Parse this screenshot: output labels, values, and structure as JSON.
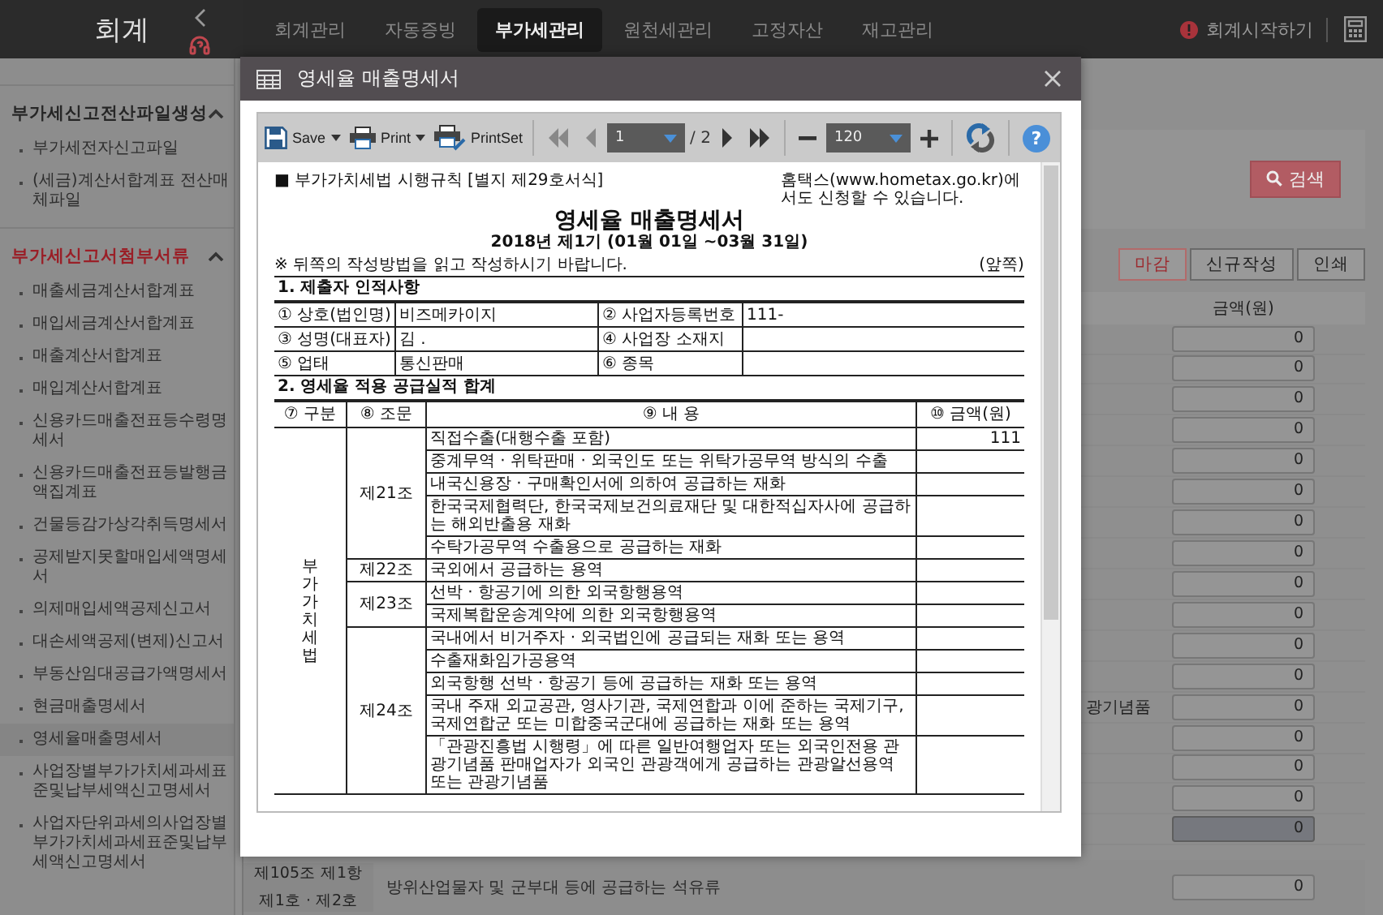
{
  "app": {
    "title": "회계"
  },
  "nav": [
    {
      "label": "회계관리",
      "selected": false
    },
    {
      "label": "자동증빙",
      "selected": false
    },
    {
      "label": "부가세관리",
      "selected": true
    },
    {
      "label": "원천세관리",
      "selected": false
    },
    {
      "label": "고정자산",
      "selected": false
    },
    {
      "label": "재고관리",
      "selected": false
    }
  ],
  "start_link": "회계시작하기",
  "sidebar": [
    {
      "title": "부가세신고전산파일생성",
      "active": false,
      "expanded": true,
      "items": [
        {
          "label": "부가세전자신고파일",
          "selected": false
        },
        {
          "label": "(세금)계산서합계표 전산매체파일",
          "selected": false
        }
      ]
    },
    {
      "title": "부가세신고서첨부서류",
      "active": true,
      "expanded": true,
      "items": [
        {
          "label": "매출세금계산서합계표",
          "selected": false
        },
        {
          "label": "매입세금계산서합계표",
          "selected": false
        },
        {
          "label": "매출계산서합계표",
          "selected": false
        },
        {
          "label": "매입계산서합계표",
          "selected": false
        },
        {
          "label": "신용카드매출전표등수령명세서",
          "selected": false
        },
        {
          "label": "신용카드매출전표등발행금액집계표",
          "selected": false
        },
        {
          "label": "건물등감가상각취득명세서",
          "selected": false
        },
        {
          "label": "공제받지못할매입세액명세서",
          "selected": false
        },
        {
          "label": "의제매입세액공제신고서",
          "selected": false
        },
        {
          "label": "대손세액공제(변제)신고서",
          "selected": false
        },
        {
          "label": "부동산임대공급가액명세서",
          "selected": false
        },
        {
          "label": "현금매출명세서",
          "selected": false
        },
        {
          "label": "영세율매출명세서",
          "selected": true
        },
        {
          "label": "사업장별부가가치세과세표준및납부세액신고명세서",
          "selected": false
        },
        {
          "label": "사업자단위과세의사업장별부가가치세과세표준및납부세액신고명세서",
          "selected": false
        }
      ]
    }
  ],
  "main": {
    "search_button": "검색",
    "actions": [
      {
        "label": "마감",
        "kind": "primary"
      },
      {
        "label": "신규작성",
        "kind": "normal"
      },
      {
        "label": "인쇄",
        "kind": "normal"
      }
    ],
    "amount_header": "금액(원)",
    "rows": [
      {
        "value": "0",
        "readonly": false
      },
      {
        "value": "0",
        "readonly": false
      },
      {
        "value": "0",
        "readonly": false
      },
      {
        "value": "0",
        "readonly": false
      },
      {
        "value": "0",
        "readonly": false
      },
      {
        "value": "0",
        "readonly": false
      },
      {
        "value": "0",
        "readonly": false
      },
      {
        "value": "0",
        "readonly": false
      },
      {
        "value": "0",
        "readonly": false
      },
      {
        "value": "0",
        "readonly": false
      },
      {
        "value": "0",
        "readonly": false
      },
      {
        "value": "0",
        "readonly": false
      },
      {
        "label": "광기념품",
        "value": "0",
        "readonly": false
      },
      {
        "value": "0",
        "readonly": false
      },
      {
        "value": "0",
        "readonly": false
      },
      {
        "value": "0",
        "readonly": false
      },
      {
        "value": "0",
        "readonly": true
      }
    ],
    "footer_row": {
      "article_lines": [
        "제105조 제1항",
        "제1호 · 제2호"
      ],
      "description": "방위산업물자 및 군부대 등에 공급하는 석유류",
      "value": "0"
    }
  },
  "dialog": {
    "title": "영세율 매출명세서",
    "toolbar": {
      "save": "Save",
      "print": "Print",
      "print_set": "PrintSet",
      "page": "1",
      "page_total": "/ 2",
      "zoom": "120",
      "help": "?"
    },
    "document": {
      "form_ref": "■ 부가가치세법 시행규칙 [별지 제29호서식]",
      "notice": "홈택스(www.hometax.go.kr)에서도 신청할 수 있습니다.",
      "title": "영세율 매출명세서",
      "period": "2018년 제1기 (01월 01일 ~03월 31일)",
      "instruction": "※ 뒤쪽의 작성방법을 읽고 작성하시기 바랍니다.",
      "side": "(앞쪽)",
      "section_1": "1. 제출자 인적사항",
      "submitter": [
        [
          "① 상호(법인명)",
          "비즈메카이지",
          "② 사업자등록번호",
          "111-"
        ],
        [
          "③ 성명(대표자)",
          "김 .",
          "④ 사업장 소재지"
        ],
        [
          "⑤ 업태",
          "통신판매",
          "⑥ 종목"
        ]
      ],
      "section_2": "2. 영세율 적용 공급실적 합계",
      "columns": [
        "⑦ 구분",
        "⑧ 조문",
        "⑨ 내 용",
        "⑩ 금액(원)"
      ],
      "groups": [
        {
          "category": "부가가치세법",
          "articles": [
            {
              "article": "제21조",
              "items": [
                {
                  "content": "직접수출(대행수출 포함)",
                  "amount": "111"
                },
                {
                  "content": "중계무역 · 위탁판매 · 외국인도 또는 위탁가공무역 방식의 수출"
                },
                {
                  "content": "내국신용장 · 구매확인서에 의하여 공급하는 재화"
                },
                {
                  "content": "한국국제협력단, 한국국제보건의료재단 및 대한적십자사에 공급하는 해외반출용 재화"
                },
                {
                  "content": "수탁가공무역 수출용으로 공급하는 재화"
                }
              ]
            },
            {
              "article": "제22조",
              "items": [
                {
                  "content": "국외에서 공급하는 용역"
                }
              ]
            },
            {
              "article": "제23조",
              "items": [
                {
                  "content": "선박 · 항공기에 의한 외국항행용역"
                },
                {
                  "content": "국제복합운송계약에 의한 외국항행용역"
                }
              ]
            },
            {
              "article": "제24조",
              "items": [
                {
                  "content": "국내에서 비거주자 · 외국법인에 공급되는 재화 또는 용역"
                },
                {
                  "content": "수출재화임가공용역"
                },
                {
                  "content": "외국항행 선박 · 항공기 등에 공급하는 재화 또는 용역"
                },
                {
                  "content": "국내 주재 외교공관, 영사기관, 국제연합과 이에 준하는 국제기구, 국제연합군 또는 미합중국군대에 공급하는 재화 또는 용역"
                },
                {
                  "content": "「관광진흥법 시행령」에 따른 일반여행업자 또는 외국인전용 관광기념품 판매업자가 외국인 관광객에게 공급하는 관광알선용역 또는 관광기념품"
                }
              ]
            }
          ]
        }
      ]
    }
  }
}
